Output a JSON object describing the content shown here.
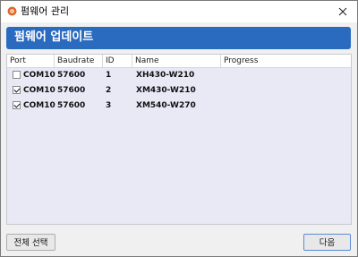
{
  "window": {
    "title": "펌웨어 관리",
    "close_glyph": "✕"
  },
  "banner": {
    "title": "펌웨어 업데이트",
    "color": "#2b6bbf"
  },
  "table": {
    "columns": [
      "Port",
      "Baudrate",
      "ID",
      "Name",
      "Progress"
    ],
    "rows": [
      {
        "checked": false,
        "port": "COM10",
        "baudrate": "57600",
        "id": "1",
        "name": "XH430-W210",
        "progress": ""
      },
      {
        "checked": true,
        "port": "COM10",
        "baudrate": "57600",
        "id": "2",
        "name": "XM430-W210",
        "progress": ""
      },
      {
        "checked": true,
        "port": "COM10",
        "baudrate": "57600",
        "id": "3",
        "name": "XM540-W270",
        "progress": ""
      }
    ]
  },
  "buttons": {
    "select_all": "전체 선택",
    "next": "다음"
  }
}
